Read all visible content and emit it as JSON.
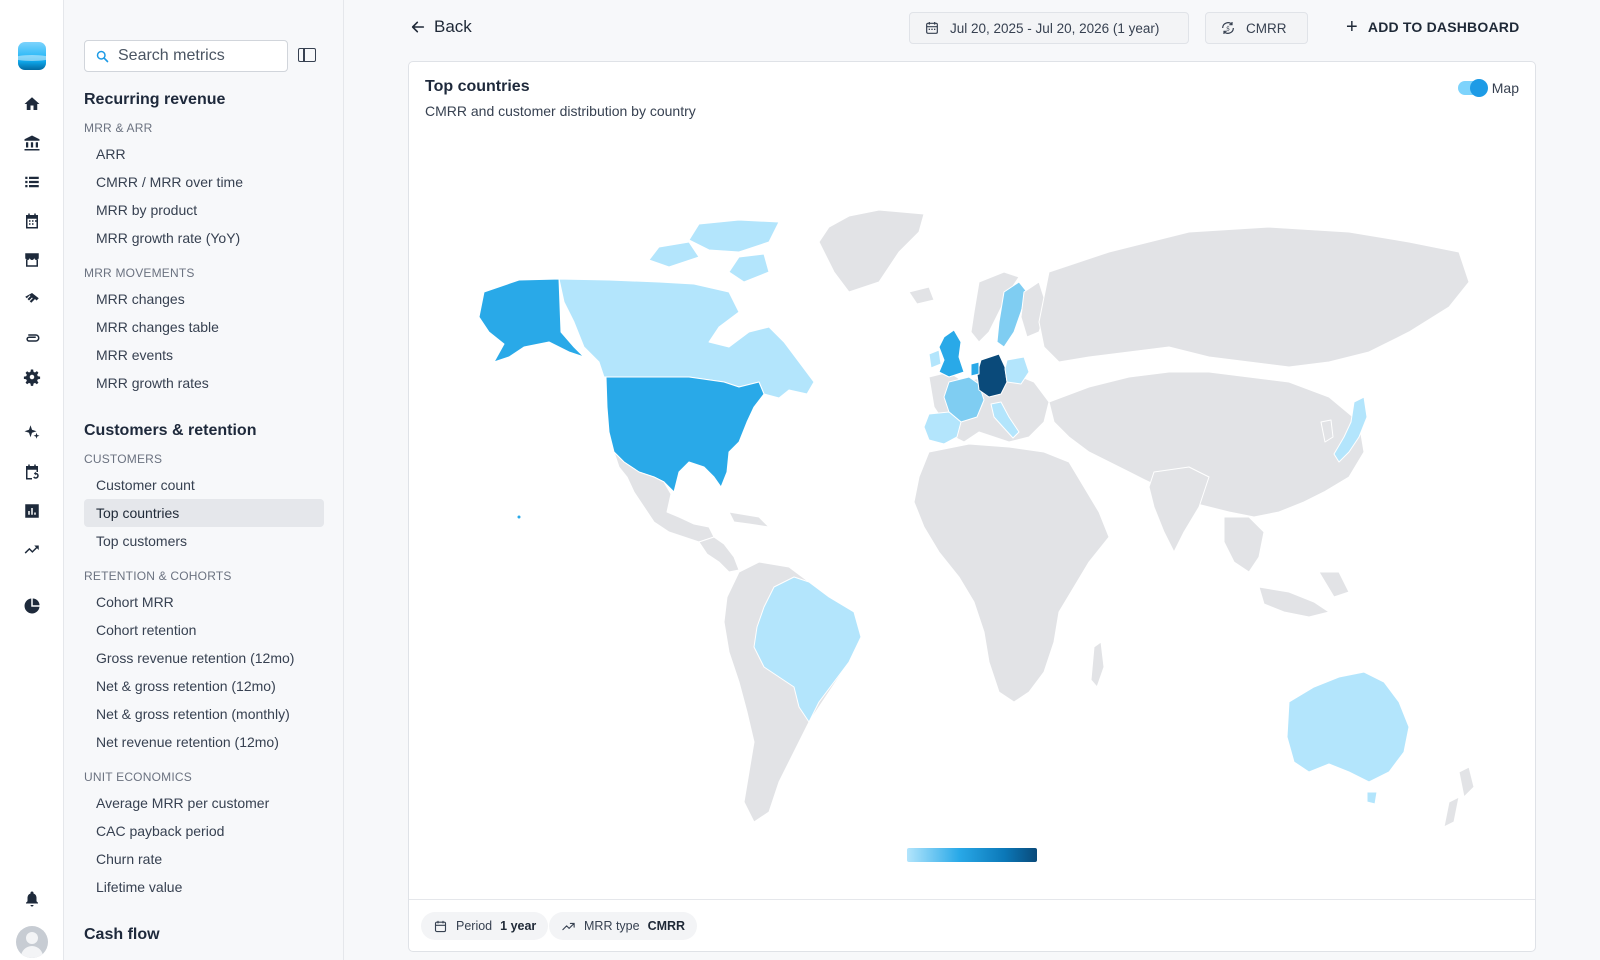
{
  "rail": {
    "icons": [
      "home-icon",
      "bank-icon",
      "list-icon",
      "calendar-icon",
      "store-icon",
      "handshake-icon",
      "paperclip-icon",
      "gear-icon",
      "sparkle-icon",
      "calendar-refresh-icon",
      "bar-chart-icon",
      "trending-up-icon",
      "pie-chart-icon",
      "bell-icon",
      "avatar"
    ]
  },
  "sidebar": {
    "search_placeholder": "Search metrics",
    "sections": [
      {
        "title": "Recurring revenue",
        "groups": [
          {
            "title": "MRR & ARR",
            "items": [
              "ARR",
              "CMRR / MRR over time",
              "MRR by product",
              "MRR growth rate (YoY)"
            ]
          },
          {
            "title": "MRR movements",
            "items": [
              "MRR changes",
              "MRR changes table",
              "MRR events",
              "MRR growth rates"
            ]
          }
        ]
      },
      {
        "title": "Customers & retention",
        "groups": [
          {
            "title": "Customers",
            "items": [
              "Customer count",
              "Top countries",
              "Top customers"
            ]
          },
          {
            "title": "Retention & cohorts",
            "items": [
              "Cohort MRR",
              "Cohort retention",
              "Gross revenue retention (12mo)",
              "Net & gross retention (12mo)",
              "Net & gross retention (monthly)",
              "Net revenue retention (12mo)"
            ]
          },
          {
            "title": "Unit economics",
            "items": [
              "Average MRR per customer",
              "CAC payback period",
              "Churn rate",
              "Lifetime value"
            ]
          }
        ]
      },
      {
        "title": "Cash flow",
        "groups": []
      }
    ],
    "active_item": "Top countries"
  },
  "topbar": {
    "back_label": "Back",
    "date_range": "Jul 20, 2025 - Jul 20, 2026 (1 year)",
    "mrr_type": "CMRR",
    "add_dashboard": "ADD TO DASHBOARD"
  },
  "card": {
    "title": "Top countries",
    "subtitle": "CMRR and customer distribution by country",
    "toggle_label": "Map",
    "toggle_on": true,
    "footer": {
      "period_label": "Period",
      "period_value": "1 year",
      "mrr_type_label": "MRR type",
      "mrr_type_value": "CMRR"
    }
  },
  "map": {
    "scale_colors": [
      "#b3e5fc",
      "#29a9e8",
      "#0a4a7a"
    ],
    "base_color": "#e2e3e6",
    "highlighted_countries": [
      {
        "name": "Germany",
        "level": 5
      },
      {
        "name": "United States",
        "level": 3
      },
      {
        "name": "United Kingdom",
        "level": 3
      },
      {
        "name": "Canada",
        "level": 1
      },
      {
        "name": "France",
        "level": 2
      },
      {
        "name": "Spain",
        "level": 1
      },
      {
        "name": "Sweden",
        "level": 2
      },
      {
        "name": "Poland",
        "level": 1
      },
      {
        "name": "Brazil",
        "level": 1
      },
      {
        "name": "Australia",
        "level": 1
      },
      {
        "name": "Japan",
        "level": 1
      },
      {
        "name": "Netherlands",
        "level": 2
      },
      {
        "name": "Austria",
        "level": 2
      }
    ]
  }
}
